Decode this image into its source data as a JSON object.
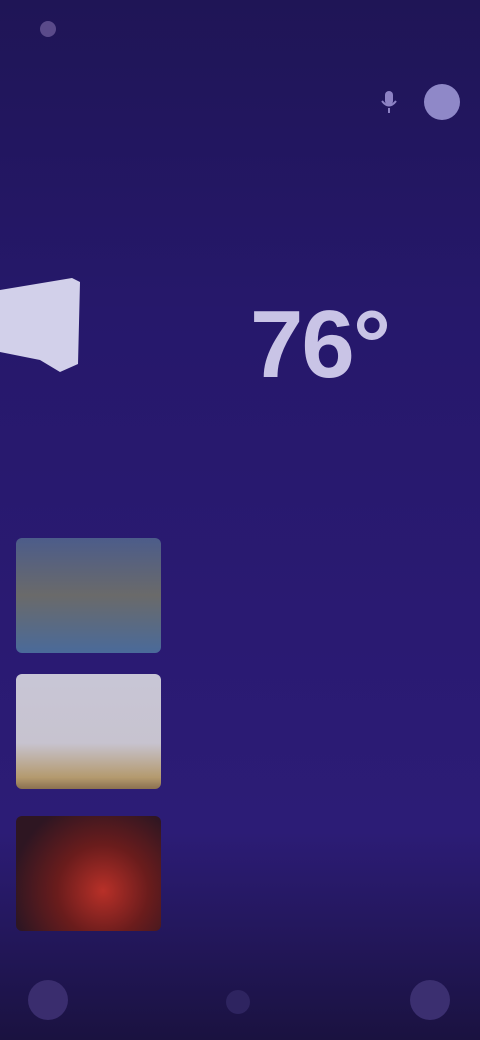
{
  "status_bar": {
    "time": "",
    "carrier": "",
    "indicators": ""
  },
  "header": {
    "subtitle": "",
    "mic_icon": "mic-icon",
    "avatar_icon": "avatar-icon"
  },
  "place": {
    "title": "",
    "subtitle": ""
  },
  "weather": {
    "temperature": "76°",
    "condition_left": "",
    "condition_right": "",
    "icon": "cloud-icon"
  },
  "section": {
    "title": ""
  },
  "news": [
    {
      "title": "",
      "meta": ""
    },
    {
      "title": "",
      "meta": ""
    },
    {
      "title": "",
      "meta": ""
    }
  ],
  "nav": {
    "left_icon": "home-icon",
    "center_icon": "circle-icon",
    "right_icon": "menu-icon"
  },
  "colors": {
    "background": "#26186b",
    "accent": "#c9c4e6"
  }
}
